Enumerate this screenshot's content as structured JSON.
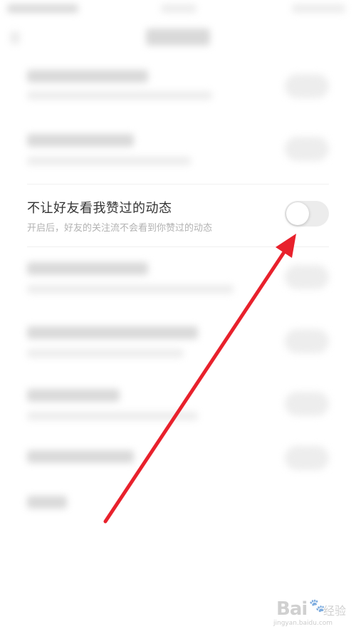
{
  "setting": {
    "title": "不让好友看我赞过的动态",
    "description": "开启后，好友的关注流不会看到你赞过的动态",
    "toggle_on": false
  },
  "watermark": {
    "brand": "Bai",
    "brand_cn": "经验",
    "url": "jingyan.baidu.com"
  },
  "colors": {
    "arrow": "#e8212c",
    "toggle_off": "#ececec"
  },
  "icons": [
    "arrow-annotation-icon",
    "baidu-paw-icon"
  ]
}
